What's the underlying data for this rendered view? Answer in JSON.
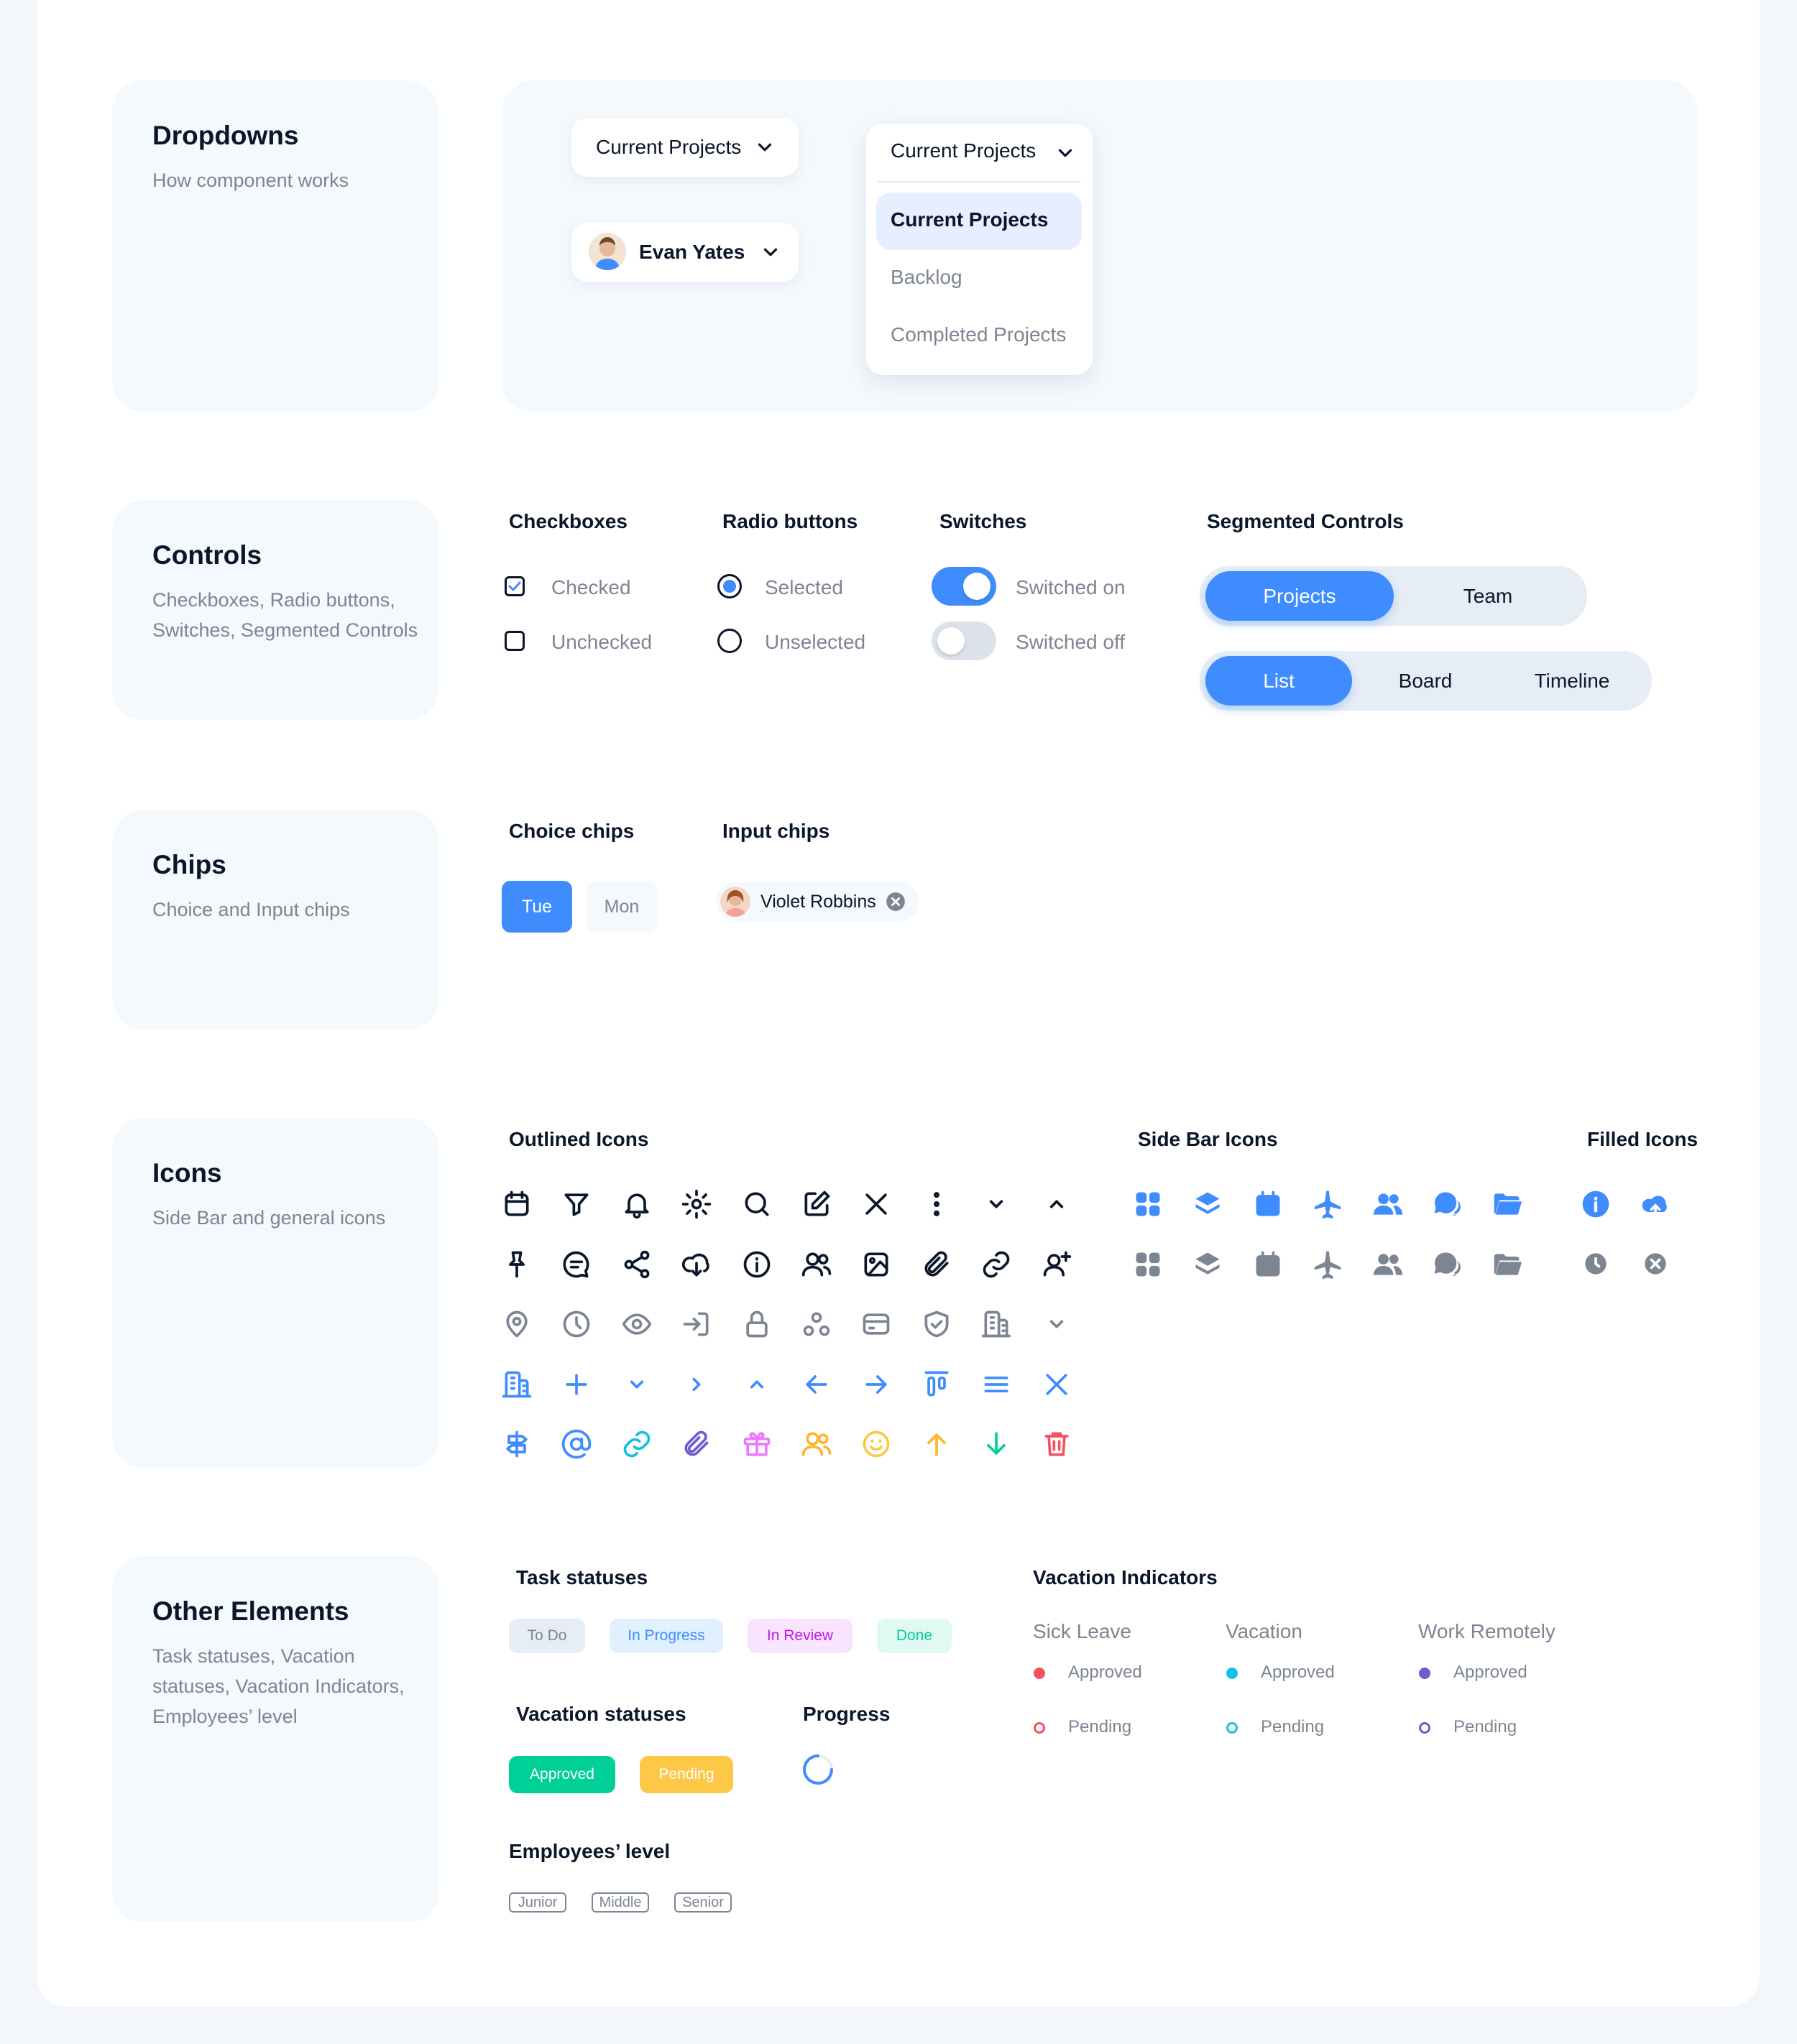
{
  "colors": {
    "primary": "#3F8CFF",
    "text": "#0A1629",
    "muted": "#7D8592",
    "card": "#F4F9FD"
  },
  "dropdowns": {
    "title": "Dropdowns",
    "subtitle": "How component works",
    "project_select": "Current Projects",
    "user_select": "Evan Yates",
    "menu": {
      "selected": "Current Projects",
      "options": [
        "Current Projects",
        "Backlog",
        "Completed Projects"
      ]
    }
  },
  "controls": {
    "title": "Controls",
    "subtitle": "Checkboxes, Radio buttons, Switches, Segmented Controls",
    "checkboxes": {
      "heading": "Checkboxes",
      "checked": "Checked",
      "unchecked": "Unchecked"
    },
    "radios": {
      "heading": "Radio buttons",
      "selected": "Selected",
      "unselected": "Unselected"
    },
    "switches": {
      "heading": "Switches",
      "on": "Switched on",
      "off": "Switched off"
    },
    "segmented": {
      "heading": "Segmented Controls",
      "first": [
        "Projects",
        "Team"
      ],
      "second": [
        "List",
        "Board",
        "Timeline"
      ]
    }
  },
  "chips": {
    "title": "Chips",
    "subtitle": "Choice and Input chips",
    "choice_heading": "Choice chips",
    "input_heading": "Input chips",
    "choice": [
      "Tue",
      "Mon"
    ],
    "input": "Violet Robbins"
  },
  "icons": {
    "title": "Icons",
    "subtitle": "Side Bar and general icons",
    "outlined_heading": "Outlined Icons",
    "sidebar_heading": "Side Bar Icons",
    "filled_heading": "Filled Icons",
    "rows": [
      [
        "calendar-icon",
        "filter-icon",
        "bell-icon",
        "gear-icon",
        "search-icon",
        "edit-icon",
        "close-icon",
        "more-vertical-icon",
        "chevron-down-icon",
        "chevron-up-icon"
      ],
      [
        "pin-icon",
        "chat-icon",
        "share-icon",
        "cloud-download-icon",
        "info-icon",
        "users-icon",
        "image-icon",
        "paperclip-icon",
        "link-icon",
        "add-user-icon"
      ],
      [
        "location-icon",
        "clock-icon",
        "eye-icon",
        "login-icon",
        "lock-icon",
        "group-icon",
        "card-icon",
        "shield-icon",
        "building-icon",
        "chevron-down-small-icon"
      ],
      [
        "building-blue-icon",
        "plus-icon",
        "chevron-down-blue-icon",
        "chevron-right-icon",
        "chevron-up-blue-icon",
        "arrow-left-icon",
        "arrow-right-icon",
        "align-top-icon",
        "menu-icon",
        "close-blue-icon"
      ],
      [
        "signpost-icon",
        "at-icon",
        "link-blue-icon",
        "paperclip-purple-icon",
        "gift-icon",
        "users-orange-icon",
        "smile-icon",
        "arrow-up-icon",
        "arrow-down-icon",
        "trash-icon"
      ]
    ],
    "sidebar": [
      "dashboard-icon",
      "layers-icon",
      "calendar-filled-icon",
      "plane-icon",
      "team-icon",
      "messages-icon",
      "folder-icon"
    ],
    "filled": [
      [
        "info-filled-icon",
        "cloud-upload-icon"
      ],
      [
        "clock-filled-icon",
        "close-circle-icon"
      ]
    ]
  },
  "other": {
    "title": "Other Elements",
    "subtitle": "Task statuses, Vacation statuses, Vacation Indicators, Employees’ level",
    "task_heading": "Task statuses",
    "tasks": [
      {
        "label": "To Do",
        "bg": "#E6EDF5",
        "fg": "#7D8592"
      },
      {
        "label": "In Progress",
        "bg": "#E0F0FF",
        "fg": "#3F8CFF"
      },
      {
        "label": "In Review",
        "bg": "#F9E4FF",
        "fg": "#C418E6"
      },
      {
        "label": "Done",
        "bg": "#E0F9F2",
        "fg": "#00D097"
      }
    ],
    "vac_heading": "Vacation statuses",
    "vac": [
      {
        "label": "Approved",
        "bg": "#00D097"
      },
      {
        "label": "Pending",
        "bg": "#FDC748"
      }
    ],
    "progress_heading": "Progress",
    "levels_heading": "Employees’ level",
    "levels": [
      "Junior",
      "Middle",
      "Senior"
    ],
    "vi_heading": "Vacation Indicators",
    "vi": [
      {
        "name": "Sick Leave",
        "color": "#F65160",
        "approved": "Approved",
        "pending": "Pending"
      },
      {
        "name": "Vacation",
        "color": "#15C0E6",
        "approved": "Approved",
        "pending": "Pending"
      },
      {
        "name": "Work Remotely",
        "color": "#6D5DD3",
        "approved": "Approved",
        "pending": "Pending"
      }
    ]
  }
}
